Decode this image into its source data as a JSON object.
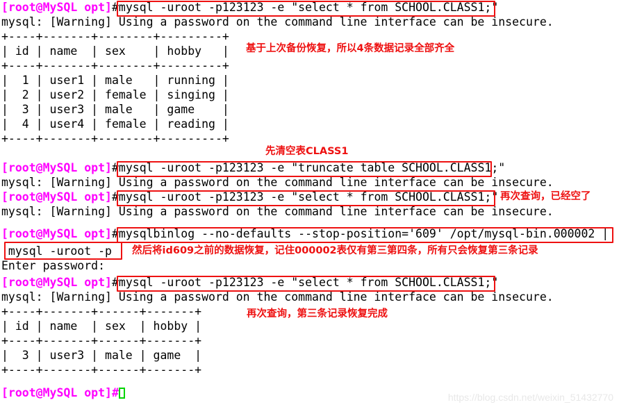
{
  "terminal": {
    "prompt": "[root@MySQL opt]",
    "hash": "#",
    "warning_line": "mysql: [Warning] Using a password on the command line interface can be insecure.",
    "enter_password": "Enter password:",
    "lines": [
      {
        "id": "l1",
        "type": "command",
        "prompt": "[root@MySQL opt]",
        "text": "#mysql -uroot -p123123 -e \"select * from SCHOOL.CLASS1;\""
      },
      {
        "id": "l2",
        "type": "output",
        "text": "mysql: [Warning] Using a password on the command line interface can be insecure."
      },
      {
        "id": "l3",
        "type": "output",
        "text": "+----+-------+--------+---------+"
      },
      {
        "id": "l4",
        "type": "output",
        "text": "| id | name  | sex    | hobby   |"
      },
      {
        "id": "l5",
        "type": "output",
        "text": "+----+-------+--------+---------+"
      },
      {
        "id": "l6",
        "type": "output",
        "text": "|  1 | user1 | male   | running |"
      },
      {
        "id": "l7",
        "type": "output",
        "text": "|  2 | user2 | female | singing |"
      },
      {
        "id": "l8",
        "type": "output",
        "text": "|  3 | user3 | male   | game    |"
      },
      {
        "id": "l9",
        "type": "output",
        "text": "|  4 | user4 | female | reading |"
      },
      {
        "id": "l10",
        "type": "output",
        "text": "+----+-------+--------+---------+"
      },
      {
        "id": "l11",
        "type": "command",
        "prompt": "[root@MySQL opt]",
        "text": "#mysql -uroot -p123123 -e \"truncate table SCHOOL.CLASS1;\""
      },
      {
        "id": "l12",
        "type": "output",
        "text": "mysql: [Warning] Using a password on the command line interface can be insecure."
      },
      {
        "id": "l13",
        "type": "command",
        "prompt": "[root@MySQL opt]",
        "text": "#mysql -uroot -p123123 -e \"select * from SCHOOL.CLASS1;\""
      },
      {
        "id": "l14",
        "type": "output",
        "text": "mysql: [Warning] Using a password on the command line interface can be insecure."
      },
      {
        "id": "l15",
        "type": "command",
        "prompt": "[root@MySQL opt]",
        "text": "#mysqlbinlog --no-defaults --stop-position='609' /opt/mysql-bin.000002 |"
      },
      {
        "id": "l16",
        "type": "output",
        "text": " mysql -uroot -p"
      },
      {
        "id": "l17",
        "type": "output",
        "text": "Enter password:"
      },
      {
        "id": "l18",
        "type": "command",
        "prompt": "[root@MySQL opt]",
        "text": "#mysql -uroot -p123123 -e \"select * from SCHOOL.CLASS1;\""
      },
      {
        "id": "l19",
        "type": "output",
        "text": "mysql: [Warning] Using a password on the command line interface can be insecure."
      },
      {
        "id": "l20",
        "type": "output",
        "text": "+----+-------+------+-------+"
      },
      {
        "id": "l21",
        "type": "output",
        "text": "| id | name  | sex  | hobby |"
      },
      {
        "id": "l22",
        "type": "output",
        "text": "+----+-------+------+-------+"
      },
      {
        "id": "l23",
        "type": "output",
        "text": "|  3 | user3 | male | game  |"
      },
      {
        "id": "l24",
        "type": "output",
        "text": "+----+-------+------+-------+"
      },
      {
        "id": "l25",
        "type": "command",
        "prompt": "[root@MySQL opt]",
        "text": "#"
      }
    ]
  },
  "commands": {
    "select1": "#mysql -uroot -p123123 -e \"select * from SCHOOL.CLASS1;\"",
    "truncate": "#mysql -uroot -p123123 -e \"truncate table SCHOOL.CLASS1;\"",
    "select2": "#mysql -uroot -p123123 -e \"select * from SCHOOL.CLASS1;\"",
    "binlog": "#mysqlbinlog --no-defaults --stop-position='609' /opt/mysql-bin.000002 |",
    "binlog_pipe": " mysql -uroot -p",
    "select3": "#mysql -uroot -p123123 -e \"select * from SCHOOL.CLASS1;\""
  },
  "tables": {
    "first": {
      "columns": [
        "id",
        "name",
        "sex",
        "hobby"
      ],
      "rows": [
        [
          "1",
          "user1",
          "male",
          "running"
        ],
        [
          "2",
          "user2",
          "female",
          "singing"
        ],
        [
          "3",
          "user3",
          "male",
          "game"
        ],
        [
          "4",
          "user4",
          "female",
          "reading"
        ]
      ]
    },
    "second": {
      "columns": [
        "id",
        "name",
        "sex",
        "hobby"
      ],
      "rows": [
        [
          "3",
          "user3",
          "male",
          "game"
        ]
      ]
    }
  },
  "annotations": [
    {
      "id": "a1",
      "text": "基于上次备份恢复，所以4条数据记录全部齐全"
    },
    {
      "id": "a2",
      "text": "先清空表CLASS1"
    },
    {
      "id": "a3",
      "text": "再次查询，已经空了"
    },
    {
      "id": "a4",
      "text": "然后将id609之前的数据恢复，记住000002表仅有第三第四条，所有只会恢复第三条记录"
    },
    {
      "id": "a5",
      "text": "再次查询，第三条记录恢复完成"
    }
  ],
  "watermark": "https://blog.csdn.net/weixin_51432770",
  "colors": {
    "prompt": "#ff00ff",
    "annotation": "#ee1111",
    "box_border": "#ee1111",
    "cursor": "#00d400",
    "text": "#000000",
    "background": "#ffffff",
    "watermark": "#e8e8e8"
  }
}
